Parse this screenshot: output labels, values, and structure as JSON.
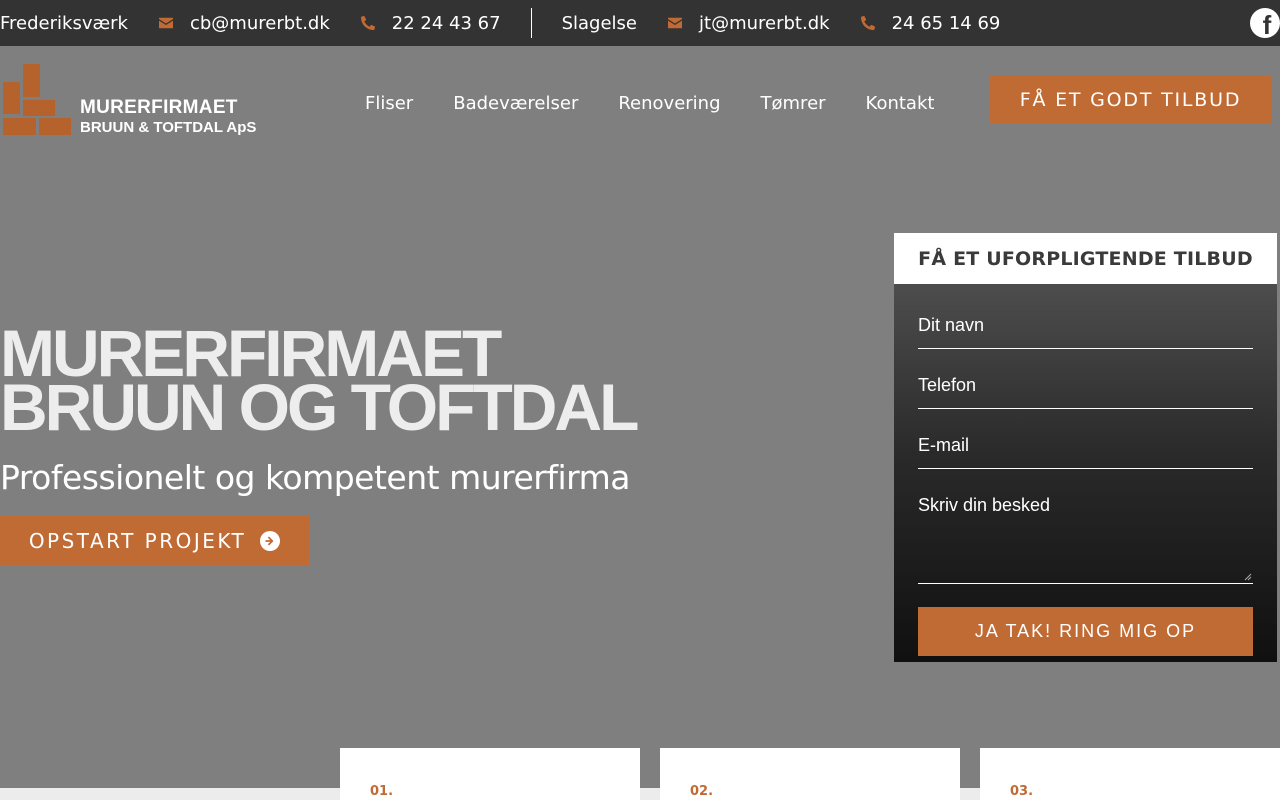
{
  "topbar": {
    "location1": "Frederiksværk",
    "email1": "cb@murerbt.dk",
    "phone1": "22 24 43 67",
    "location2": "Slagelse",
    "email2": "jt@murerbt.dk",
    "phone2": "24 65 14 69",
    "facebook_glyph": "f"
  },
  "logo": {
    "line1": "MURERFIRMAET",
    "line2": "BRUUN & TOFTDAL ApS"
  },
  "nav": {
    "items": [
      "Fliser",
      "Badeværelser",
      "Renovering",
      "Tømrer",
      "Kontakt"
    ]
  },
  "header_cta": "FÅ ET GODT TILBUD",
  "hero": {
    "title_line1": "MURERFIRMAET",
    "title_line2": "BRUUN OG TOFTDAL",
    "subtitle": "Professionelt og kompetent murerfirma",
    "button": "OPSTART PROJEKT"
  },
  "form": {
    "heading": "FÅ ET UFORPLIGTENDE TILBUD",
    "name_placeholder": "Dit navn",
    "phone_placeholder": "Telefon",
    "email_placeholder": "E-mail",
    "message_placeholder": "Skriv din besked",
    "submit": "JA TAK! RING MIG OP"
  },
  "cards": [
    "01.",
    "02.",
    "03."
  ],
  "colors": {
    "accent": "#c06a34",
    "topbar": "#333333",
    "hero_bg": "#7f7f7f"
  },
  "icons": [
    "envelope-icon",
    "phone-icon",
    "facebook-icon",
    "arrow-circle-right-icon"
  ]
}
